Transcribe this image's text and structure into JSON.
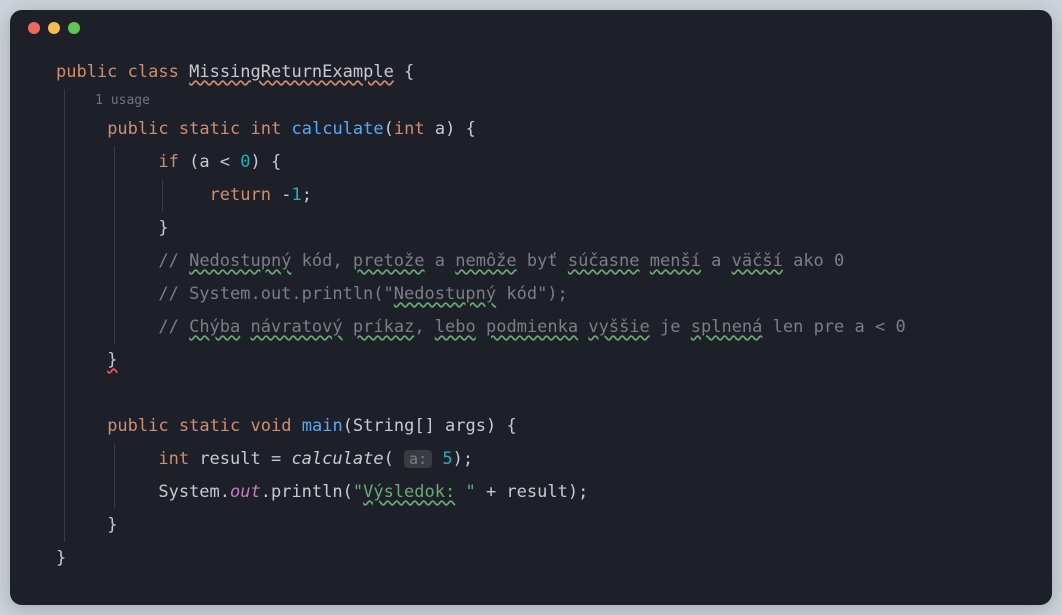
{
  "titlebar": {
    "red": "close",
    "yellow": "minimize",
    "green": "maximize"
  },
  "code": {
    "l1_public": "public",
    "l1_class": "class",
    "l1_name": "MissingReturnExample",
    "l1_brace": " {",
    "usage": "1 usage",
    "l2_public": "public",
    "l2_static": "static",
    "l2_int": "int",
    "l2_method": "calculate",
    "l2_params_open": "(",
    "l2_param_type": "int",
    "l2_param_name": " a",
    "l2_params_close": ")",
    "l2_brace": " {",
    "l3_if": "if",
    "l3_cond": " (a < ",
    "l3_zero": "0",
    "l3_close": ") ",
    "l3_brace": "{",
    "l4_return": "return",
    "l4_sp": " ",
    "l4_neg": "-",
    "l4_one": "1",
    "l4_semi": ";",
    "l5_brace": "}",
    "l6_comment_pre": "// ",
    "l6_w1": "Nedostupný",
    "l6_t1": " kód, ",
    "l6_w2": "pretože",
    "l6_t2": " a ",
    "l6_w3": "nemôže",
    "l6_t3": " byť ",
    "l6_w4": "súčasne",
    "l6_t4": " ",
    "l6_w5": "menší",
    "l6_t5": " a ",
    "l6_w6": "väčší",
    "l6_t6": " ako 0",
    "l7_comment_pre": "// System.out.println(\"",
    "l7_w1": "Nedostupný",
    "l7_rest": " kód\");",
    "l8_comment_pre": "// ",
    "l8_w1": "Chýba",
    "l8_t1": " ",
    "l8_w2": "návratový",
    "l8_t2": " ",
    "l8_w3": "príkaz",
    "l8_t3": ", ",
    "l8_w4": "lebo",
    "l8_t4": " ",
    "l8_w5": "podmienka",
    "l8_t5": " ",
    "l8_w6": "vyššie",
    "l8_t6": " je ",
    "l8_w7": "splnená",
    "l8_t7": " len pre a < 0",
    "l9_brace": "}",
    "l11_public": "public",
    "l11_static": "static",
    "l11_void": "void",
    "l11_method": "main",
    "l11_params": "(String[] args) ",
    "l11_brace": "{",
    "l12_int": "int",
    "l12_var": " result = ",
    "l12_call": "calculate",
    "l12_open": "( ",
    "l12_hint": "a:",
    "l12_sp": " ",
    "l12_arg": "5",
    "l12_close": ");",
    "l13_sys": "System.",
    "l13_out": "out",
    "l13_print": ".println(",
    "l13_str_open": "\"",
    "l13_str_w": "Výsledok:",
    "l13_str_rest": " \"",
    "l13_concat": " + result);",
    "l14_brace": "}",
    "l15_brace": "}"
  }
}
